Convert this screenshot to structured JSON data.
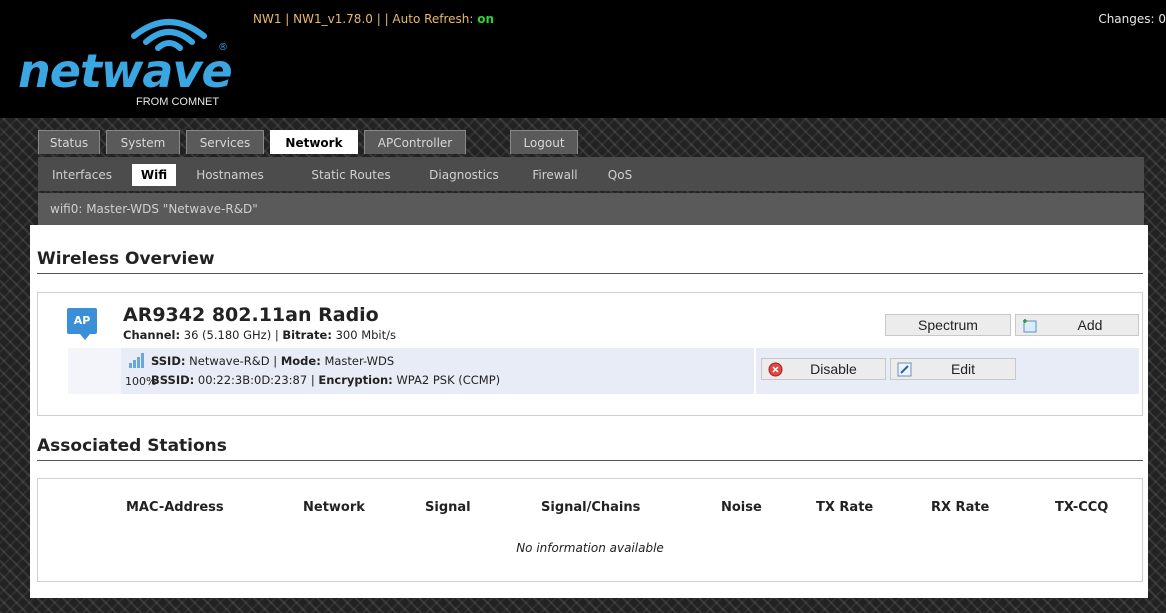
{
  "header": {
    "brand": "netwave",
    "brand_mark": "®",
    "brand_sub": "FROM COMNET",
    "info_prefix": "NW1 | NW1_v1.78.0 | | Auto Refresh: ",
    "auto_refresh": "on",
    "changes": "Changes: 0"
  },
  "tabs": [
    "Status",
    "System",
    "Services",
    "Network",
    "APController",
    "Logout"
  ],
  "active_tab": "Network",
  "subtabs": [
    "Interfaces",
    "Wifi",
    "Hostnames",
    "Static Routes",
    "Diagnostics",
    "Firewall",
    "QoS"
  ],
  "active_subtab": "Wifi",
  "wifi_bar": "wifi0: Master-WDS \"Netwave-R&D\"",
  "wireless_overview": {
    "title": "Wireless Overview",
    "badge": "AP",
    "radio_name": "AR9342 802.11an Radio",
    "channel_label": "Channel:",
    "channel_value": " 36 (5.180 GHz) | ",
    "bitrate_label": "Bitrate:",
    "bitrate_value": " 300 Mbit/s",
    "spectrum_button": "Spectrum",
    "add_button": "Add",
    "network": {
      "signal_pct": "100%",
      "ssid_label": "SSID:",
      "ssid_value": " Netwave-R&D | ",
      "mode_label": "Mode:",
      "mode_value": " Master-WDS",
      "bssid_label": "BSSID:",
      "bssid_value": " 00:22:3B:0D:23:87 | ",
      "enc_label": "Encryption:",
      "enc_value": " WPA2 PSK (CCMP)",
      "disable_button": "Disable",
      "edit_button": "Edit"
    }
  },
  "associated_stations": {
    "title": "Associated Stations",
    "columns": [
      "MAC-Address",
      "Network",
      "Signal",
      "Signal/Chains",
      "Noise",
      "TX Rate",
      "RX Rate",
      "TX-CCQ"
    ],
    "empty_text": "No information available"
  },
  "colors": {
    "brand_blue": "#3aa6e2",
    "auto_refresh_on": "#2fd32f",
    "header_info": "#e7b96a",
    "ap_badge": "#3a8fd6"
  },
  "icons": [
    "wifi-wave-icon",
    "signal-bars-icon",
    "add-network-icon",
    "disable-icon",
    "edit-icon"
  ]
}
